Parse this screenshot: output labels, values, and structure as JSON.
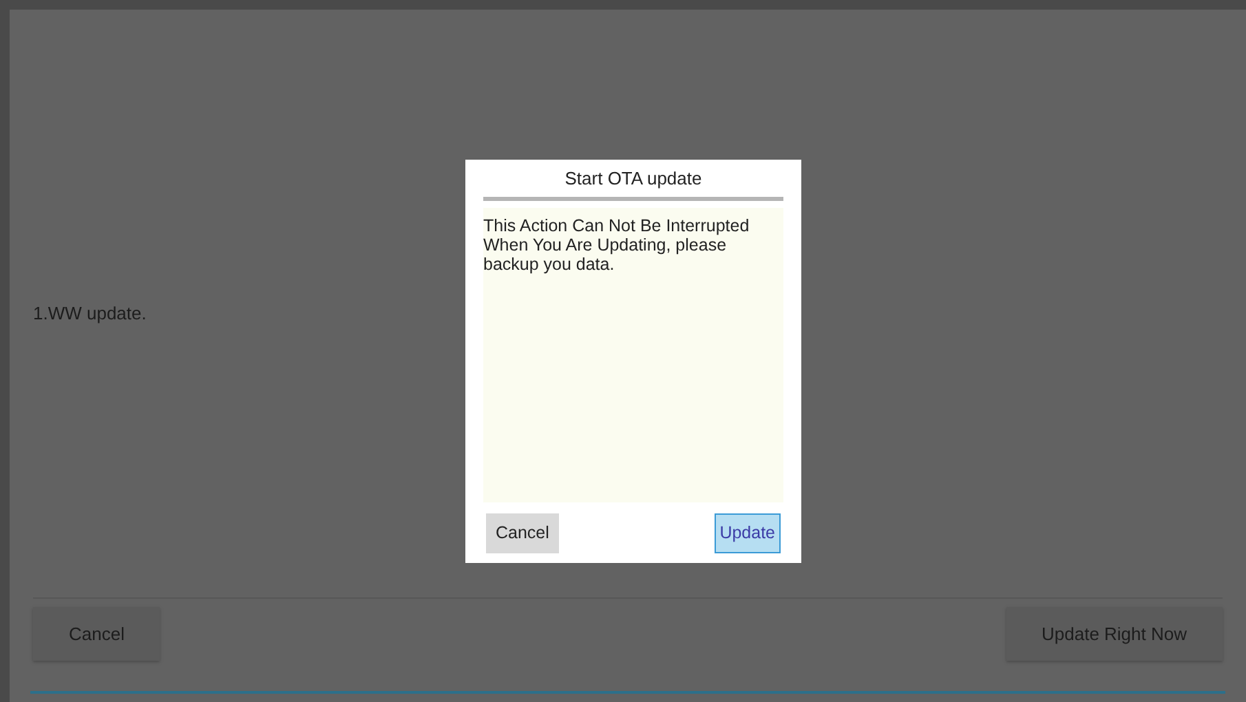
{
  "page": {
    "item": "1.WW update.",
    "buttons": [
      {
        "label": "Cancel"
      },
      {
        "label": "Update Right Now"
      }
    ]
  },
  "dialog": {
    "title": "Start OTA update",
    "message": "This Action Can Not Be Interrupted When You Are Updating, please backup you data.",
    "buttons": [
      {
        "label": "Cancel",
        "selected": false
      },
      {
        "label": "Update",
        "selected": true
      }
    ]
  }
}
